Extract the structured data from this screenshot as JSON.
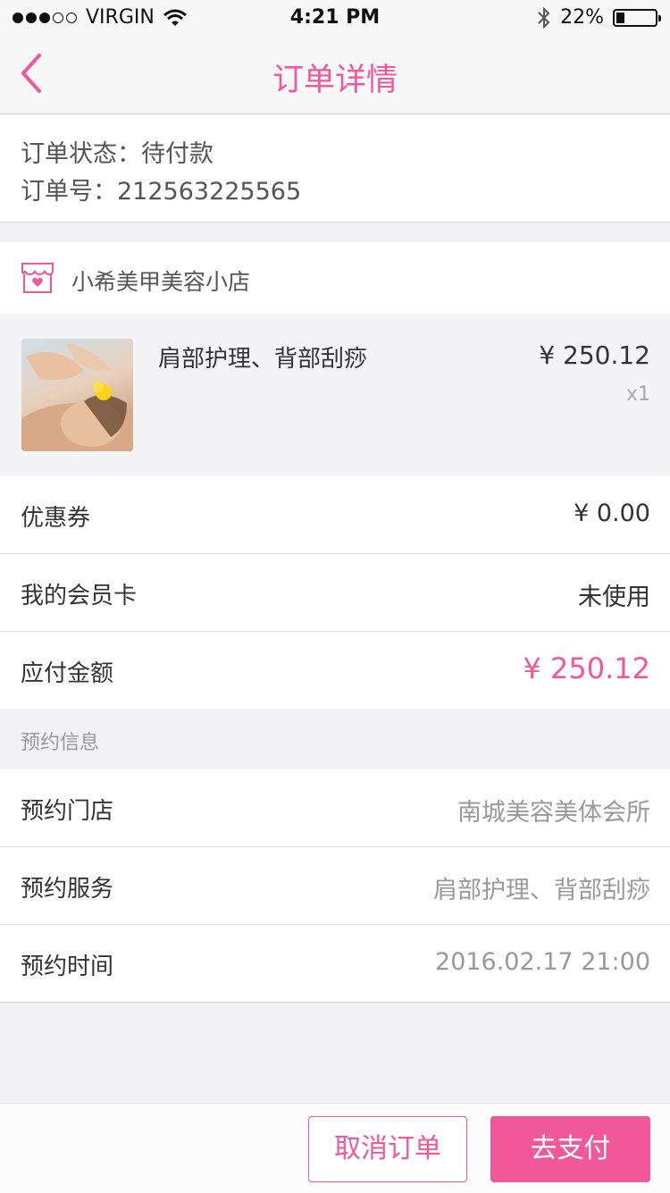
{
  "status_bar": {
    "carrier": "VIRGIN",
    "time": "4:21 PM",
    "battery": "22%",
    "battery_level": 0.22,
    "signal_bars": 3
  },
  "nav": {
    "title": "订单详情",
    "back_icon": "chevron-left-icon"
  },
  "order": {
    "status_line": "订单状态：待付款",
    "number_line": "订单号：212563225565"
  },
  "shop": {
    "icon": "shop-icon",
    "name": "小希美甲美容小店"
  },
  "product": {
    "name": "肩部护理、背部刮痧",
    "price": "¥ 250.12",
    "quantity": "x1"
  },
  "summary": [
    {
      "label": "优惠券",
      "value": "¥ 0.00"
    },
    {
      "label": "我的会员卡",
      "value": "未使用"
    },
    {
      "label": "应付金额",
      "value": "¥ 250.12"
    }
  ],
  "booking": {
    "section_title": "预约信息",
    "rows": [
      {
        "label": "预约门店",
        "value": "南城美容美体会所"
      },
      {
        "label": "预约服务",
        "value": "肩部护理、背部刮痧"
      },
      {
        "label": "预约时间",
        "value": "2016.02.17 21:00"
      }
    ]
  },
  "actions": {
    "cancel": "取消订单",
    "pay": "去支付"
  },
  "colors": {
    "accent": "#f0589a",
    "background": "#f2f2f4"
  }
}
